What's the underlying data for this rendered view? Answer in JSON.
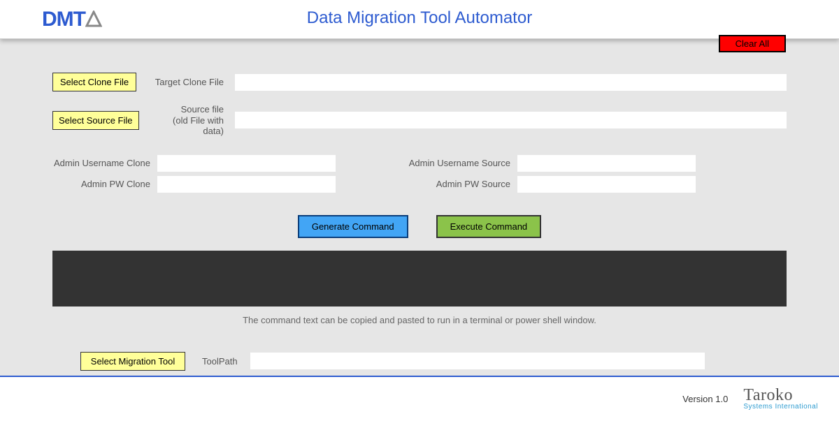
{
  "header": {
    "logo_text": "DMTA",
    "app_title": "Data Migration Tool Automator"
  },
  "buttons": {
    "clear_all": "Clear All",
    "select_clone_file": "Select Clone File",
    "select_source_file": "Select Source File",
    "generate_command": "Generate Command",
    "execute_command": "Execute Command",
    "select_migration_tool": "Select Migration Tool"
  },
  "labels": {
    "target_clone_file": "Target Clone File",
    "source_file_line1": "Source file",
    "source_file_line2": "(old File with data)",
    "admin_user_clone": "Admin Username Clone",
    "admin_pw_clone": "Admin PW Clone",
    "admin_user_source": "Admin Username Source",
    "admin_pw_source": "Admin PW Source",
    "tool_path": "ToolPath"
  },
  "inputs": {
    "target_clone_file": "",
    "source_file": "",
    "admin_user_clone": "",
    "admin_pw_clone": "",
    "admin_user_source": "",
    "admin_pw_source": "",
    "command_output": "",
    "tool_path": ""
  },
  "hint": "The command text can be copied and pasted to run in a terminal or power shell window.",
  "footer": {
    "version": "Version 1.0",
    "vendor_name": "Taroko",
    "vendor_sub": "Systems International"
  }
}
